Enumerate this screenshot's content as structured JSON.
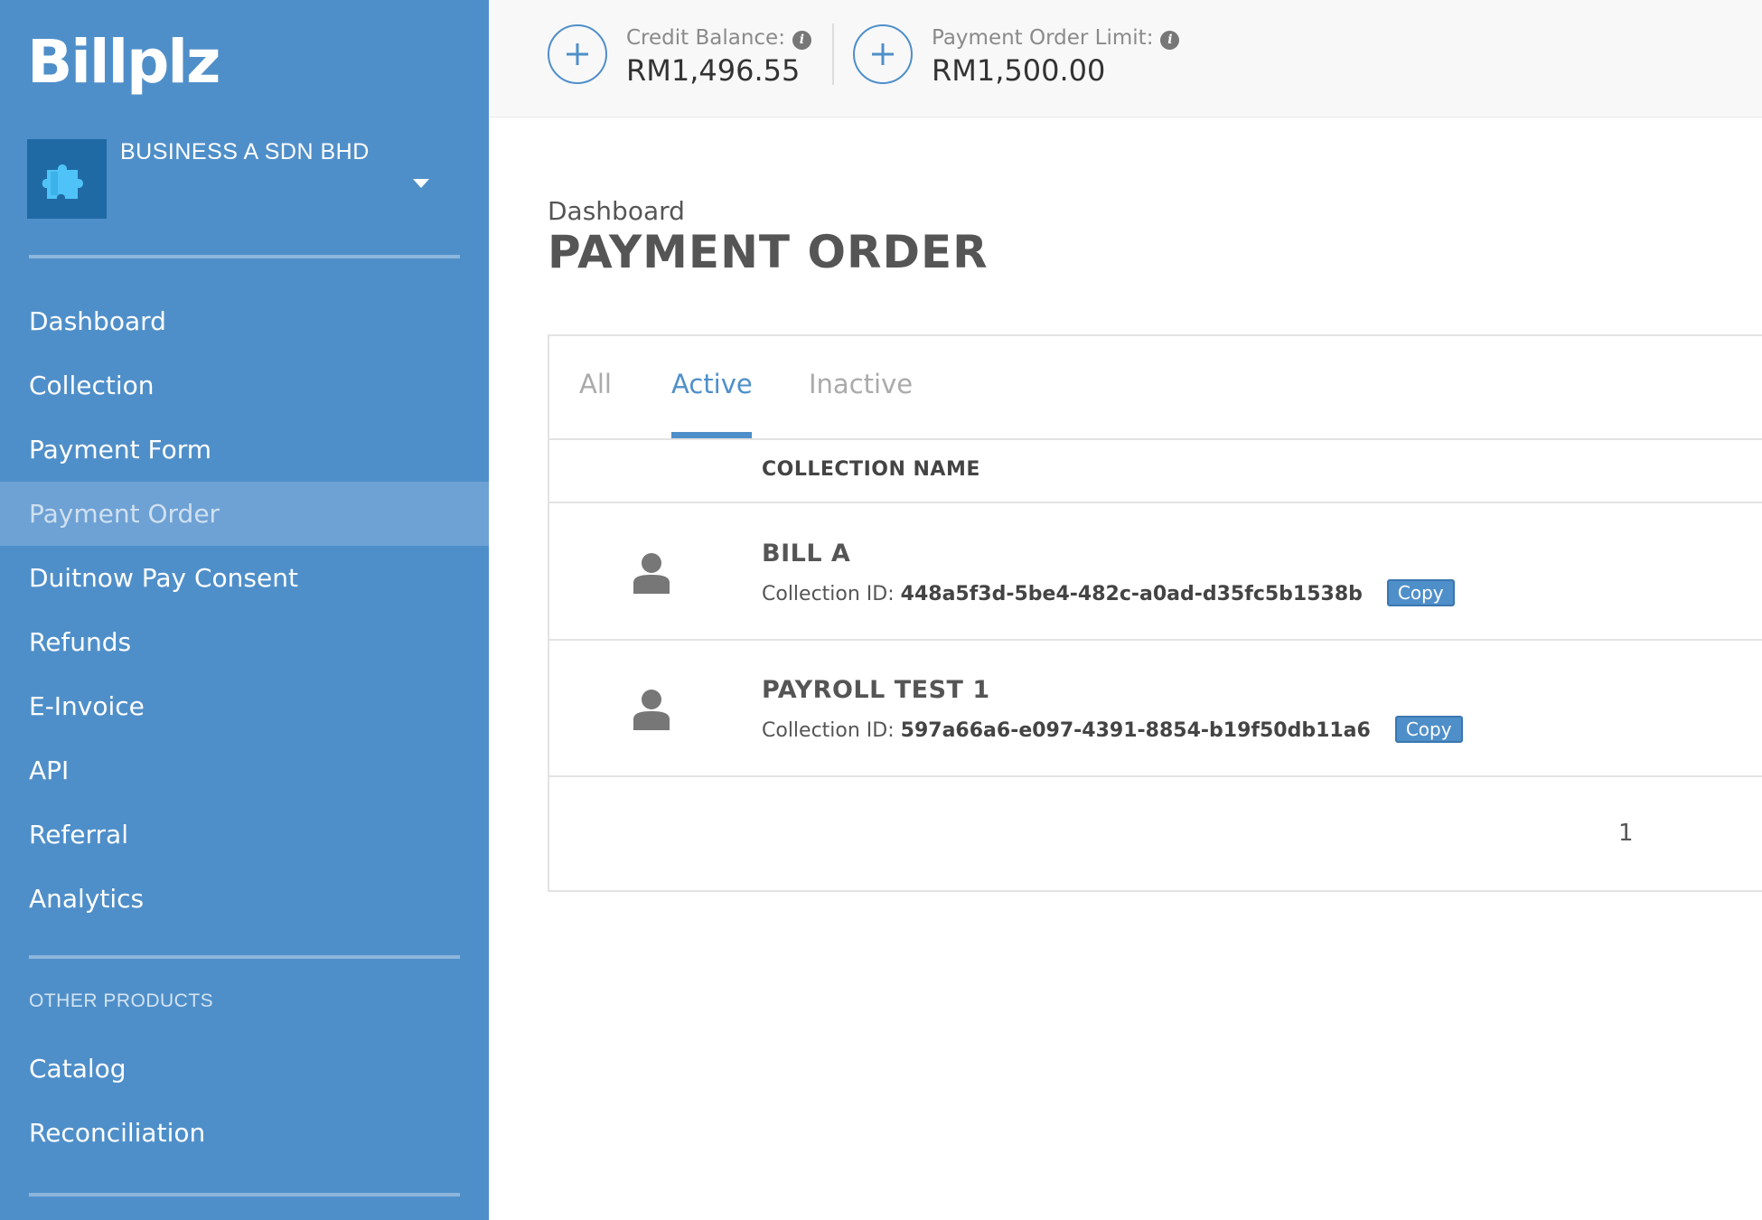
{
  "sidebar": {
    "logo": "Billplz",
    "account_name": "BUSINESS A SDN BHD",
    "nav_items": [
      {
        "label": "Dashboard"
      },
      {
        "label": "Collection"
      },
      {
        "label": "Payment Form"
      },
      {
        "label": "Payment Order",
        "active": true
      },
      {
        "label": "Duitnow Pay Consent"
      },
      {
        "label": "Refunds"
      },
      {
        "label": "E-Invoice"
      },
      {
        "label": "API"
      },
      {
        "label": "Referral"
      },
      {
        "label": "Analytics"
      }
    ],
    "section_label": "OTHER PRODUCTS",
    "other_items": [
      {
        "label": "Catalog"
      },
      {
        "label": "Reconciliation"
      }
    ]
  },
  "topbar": {
    "credit_balance_label": "Credit Balance:",
    "credit_balance_value": "RM1,496.55",
    "order_limit_label": "Payment Order Limit:",
    "order_limit_value": "RM1,500.00"
  },
  "page": {
    "breadcrumb": "Dashboard",
    "title": "PAYMENT ORDER"
  },
  "tabs": [
    {
      "label": "All"
    },
    {
      "label": "Active",
      "active": true
    },
    {
      "label": "Inactive"
    }
  ],
  "table": {
    "column_header": "COLLECTION NAME",
    "id_label": "Collection ID:",
    "copy_label": "Copy",
    "rows": [
      {
        "name": "BILL A",
        "collection_id": "448a5f3d-5be4-482c-a0ad-d35fc5b1538b"
      },
      {
        "name": "PAYROLL TEST 1",
        "collection_id": "597a66a6-e097-4391-8854-b19f50db11a6"
      }
    ],
    "page_number": "1"
  },
  "colors": {
    "sidebar_bg": "#4f8fc9",
    "accent": "#4f8fc9",
    "active_nav_bg": "#6ea1d4"
  },
  "icons": {
    "account_avatar": "puzzle-icon",
    "info": "info-icon",
    "add": "plus-circle-icon",
    "row_avatar": "person-icon"
  }
}
